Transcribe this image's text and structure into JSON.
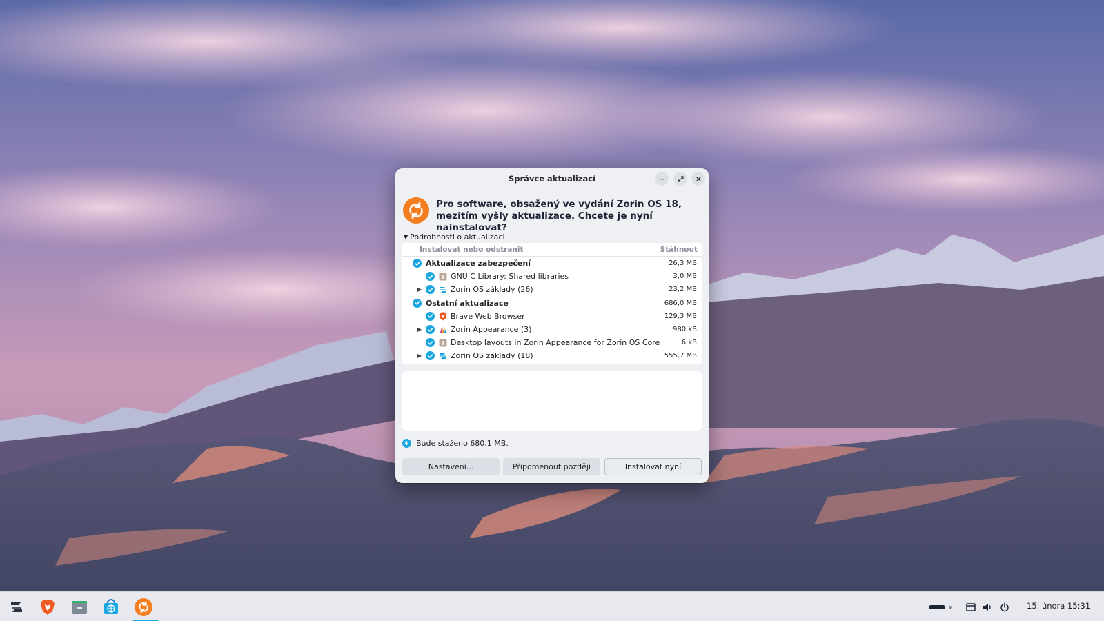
{
  "colors": {
    "accent": "#1aa6e0",
    "updater_orange": "#f47f20",
    "dialog_bg": "#eef0f4"
  },
  "dialog": {
    "title": "Správce aktualizací",
    "window_buttons": [
      "minimize-icon",
      "maximize-icon",
      "close-icon"
    ],
    "headline": "Pro software, obsažený ve vydání Zorin OS 18, mezitím vyšly aktualizace. Chcete je nyní nainstalovat?",
    "details_label": "Podrobnosti o aktualizaci",
    "columns": {
      "name": "Instalovat nebo odstranit",
      "size": "Stáhnout"
    },
    "rows": [
      {
        "kind": "group",
        "label": "Aktualizace zabezpečení",
        "size": "26,3 MB",
        "icon": "",
        "expander": false
      },
      {
        "kind": "item",
        "label": "GNU C Library: Shared libraries",
        "size": "3,0 MB",
        "icon": "package-icon",
        "expander": false
      },
      {
        "kind": "item",
        "label": "Zorin OS základy (26)",
        "size": "23,2 MB",
        "icon": "zorin-icon",
        "expander": true
      },
      {
        "kind": "group",
        "label": "Ostatní aktualizace",
        "size": "686,0 MB",
        "icon": "",
        "expander": false
      },
      {
        "kind": "item",
        "label": "Brave Web Browser",
        "size": "129,3 MB",
        "icon": "brave-icon",
        "expander": false
      },
      {
        "kind": "item",
        "label": "Zorin Appearance (3)",
        "size": "980 kB",
        "icon": "appearance-icon",
        "expander": true
      },
      {
        "kind": "item",
        "label": "Desktop layouts in Zorin Appearance for Zorin OS Core",
        "size": "6 kB",
        "icon": "package-icon",
        "expander": false
      },
      {
        "kind": "item",
        "label": "Zorin OS základy (18)",
        "size": "555,7 MB",
        "icon": "zorin-icon",
        "expander": true
      }
    ],
    "download_info": "Bude staženo 680,1 MB.",
    "buttons": {
      "settings": "Nastavení...",
      "remind": "Připomenout později",
      "install": "Instalovat nyní"
    }
  },
  "taskbar": {
    "apps": [
      "zorin-menu-icon",
      "brave-icon",
      "files-icon",
      "software-store-icon",
      "updater-icon"
    ],
    "tray_icons": [
      "workspace-indicator-icon",
      "network-icon",
      "volume-icon",
      "power-icon"
    ],
    "clock": "15. února  15:31"
  }
}
